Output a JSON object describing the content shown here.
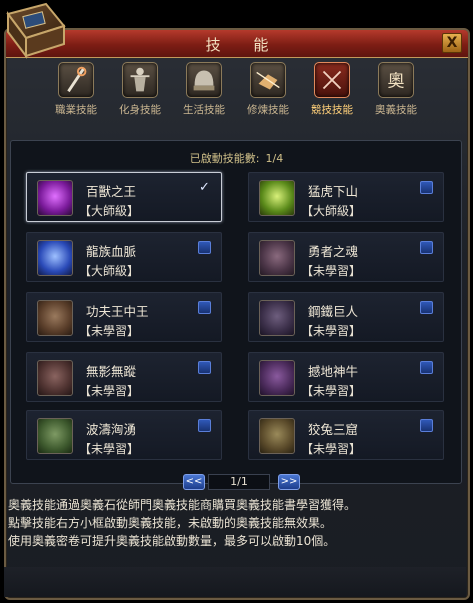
{
  "window": {
    "title": "技 能",
    "close_label": "X"
  },
  "tabs": [
    {
      "label": "職業技能",
      "icon": "staff-icon",
      "active": false
    },
    {
      "label": "化身技能",
      "icon": "warrior-icon",
      "active": false
    },
    {
      "label": "生活技能",
      "icon": "helmet-icon",
      "active": false
    },
    {
      "label": "修煉技能",
      "icon": "fist-icon",
      "active": false
    },
    {
      "label": "競技技能",
      "icon": "crossed-swords-icon",
      "active": true
    },
    {
      "label": "奧義技能",
      "icon": "ao-glyph-icon",
      "active": false
    }
  ],
  "enabled": {
    "label": "已啟動技能數:",
    "count": "1/4"
  },
  "skills": [
    {
      "name": "百獸之王",
      "level": "【大師級】",
      "checked": true,
      "selected": true,
      "icon_color": "#b03ad0",
      "icon": "lion-icon"
    },
    {
      "name": "猛虎下山",
      "level": "【大師級】",
      "checked": false,
      "selected": false,
      "icon_color": "#8fc23a",
      "icon": "tiger-icon"
    },
    {
      "name": "龍族血脈",
      "level": "【大師級】",
      "checked": false,
      "selected": false,
      "icon_color": "#3a6bd6",
      "icon": "dragon-icon"
    },
    {
      "name": "勇者之魂",
      "level": "【未學習】",
      "checked": false,
      "selected": false,
      "icon_color": "#6a4e62",
      "icon": "soul-icon"
    },
    {
      "name": "功夫王中王",
      "level": "【未學習】",
      "checked": false,
      "selected": false,
      "icon_color": "#7a5742",
      "icon": "kungfu-icon"
    },
    {
      "name": "鋼鐵巨人",
      "level": "【未學習】",
      "checked": false,
      "selected": false,
      "icon_color": "#4d4258",
      "icon": "giant-icon"
    },
    {
      "name": "無影無蹤",
      "level": "【未學習】",
      "checked": false,
      "selected": false,
      "icon_color": "#6a4a46",
      "icon": "shadow-icon"
    },
    {
      "name": "撼地神牛",
      "level": "【未學習】",
      "checked": false,
      "selected": false,
      "icon_color": "#5e3a6a",
      "icon": "bull-icon"
    },
    {
      "name": "波濤洶湧",
      "level": "【未學習】",
      "checked": false,
      "selected": false,
      "icon_color": "#4f6a42",
      "icon": "wave-icon"
    },
    {
      "name": "狡兔三窟",
      "level": "【未學習】",
      "checked": false,
      "selected": false,
      "icon_color": "#6a5a3a",
      "icon": "rabbit-icon"
    }
  ],
  "pager": {
    "text": "1/1",
    "prev_label": "<<",
    "next_label": ">>"
  },
  "description": [
    "奧義技能通過奧義石從師門奧義技能商購買奧義技能書學習獲得。",
    "點擊技能右方小框啟動奧義技能，未啟動的奧義技能無效果。",
    "使用奧義密卷可提升奧義技能啟動數量，最多可以啟動10個。"
  ],
  "check_glyph": "✓"
}
